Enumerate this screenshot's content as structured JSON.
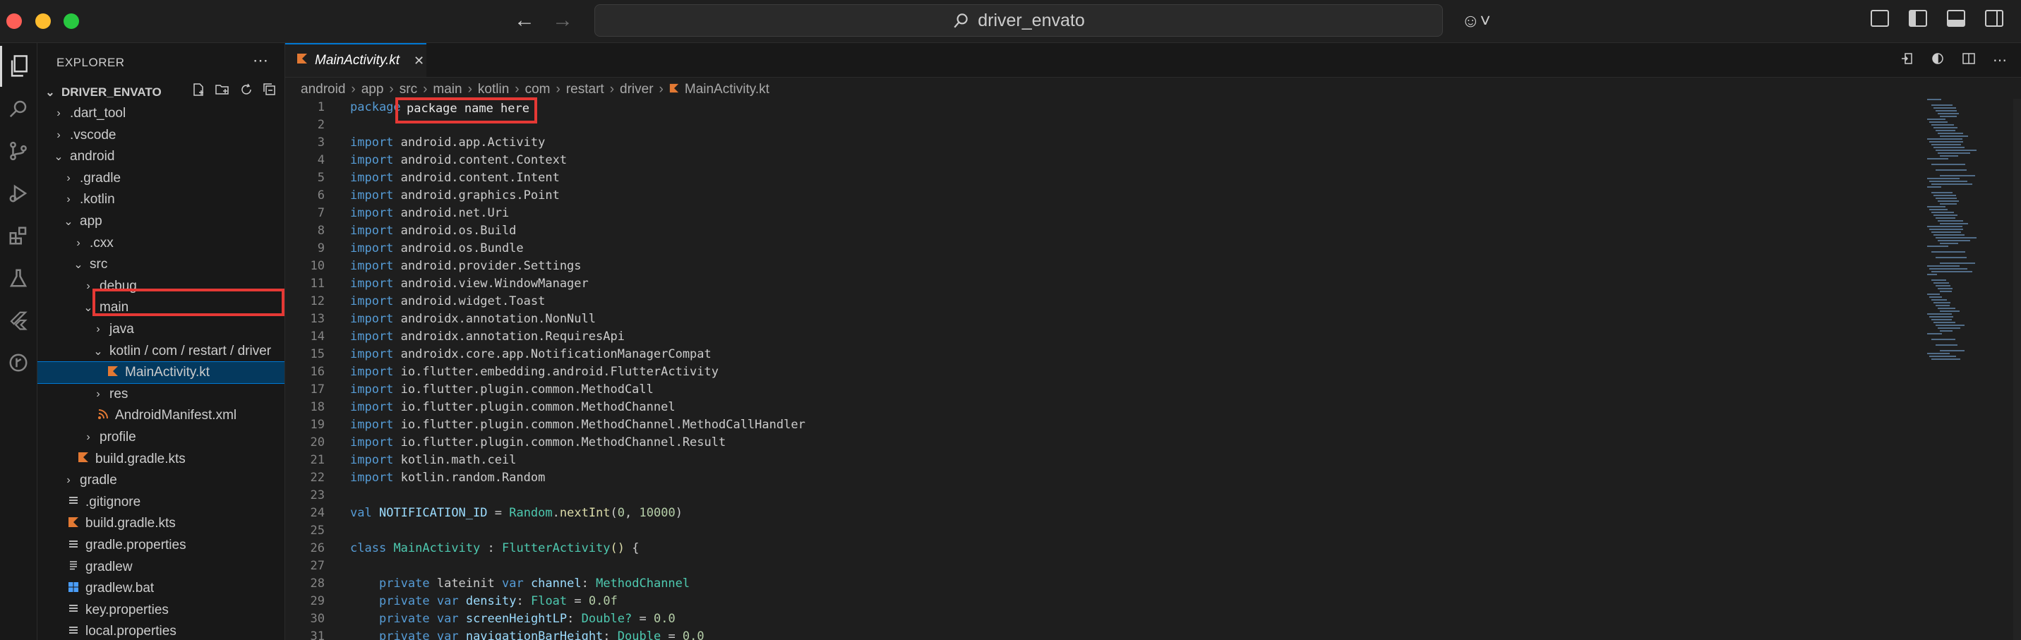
{
  "window": {
    "search_text": "driver_envato"
  },
  "activity_bar": {
    "icons": [
      "explorer-icon",
      "search-icon",
      "source-control-icon",
      "run-debug-icon",
      "extensions-icon",
      "testing-icon",
      "flutter-icon",
      "git-graph-icon"
    ]
  },
  "sidebar": {
    "header": "EXPLORER",
    "root_label": "DRIVER_ENVATO",
    "tree": [
      {
        "label": ".dart_tool",
        "depth": 0,
        "chevron": "right"
      },
      {
        "label": ".vscode",
        "depth": 0,
        "chevron": "right"
      },
      {
        "label": "android",
        "depth": 0,
        "chevron": "down"
      },
      {
        "label": ".gradle",
        "depth": 1,
        "chevron": "right"
      },
      {
        "label": ".kotlin",
        "depth": 1,
        "chevron": "right"
      },
      {
        "label": "app",
        "depth": 1,
        "chevron": "down"
      },
      {
        "label": ".cxx",
        "depth": 2,
        "chevron": "right"
      },
      {
        "label": "src",
        "depth": 2,
        "chevron": "down"
      },
      {
        "label": "debug",
        "depth": 3,
        "chevron": "right"
      },
      {
        "label": "main",
        "depth": 3,
        "chevron": "down"
      },
      {
        "label": "java",
        "depth": 4,
        "chevron": "right"
      },
      {
        "label": "kotlin / com / restart / driver",
        "depth": 4,
        "chevron": "down"
      },
      {
        "label": "MainActivity.kt",
        "depth": 5,
        "icon": "kotlin",
        "selected": true
      },
      {
        "label": "res",
        "depth": 4,
        "chevron": "right"
      },
      {
        "label": "AndroidManifest.xml",
        "depth": 4,
        "icon": "xml"
      },
      {
        "label": "profile",
        "depth": 3,
        "chevron": "right"
      },
      {
        "label": "build.gradle.kts",
        "depth": 2,
        "icon": "kotlin"
      },
      {
        "label": "gradle",
        "depth": 1,
        "chevron": "right"
      },
      {
        "label": ".gitignore",
        "depth": 1,
        "icon": "gear"
      },
      {
        "label": "build.gradle.kts",
        "depth": 1,
        "icon": "kotlin"
      },
      {
        "label": "gradle.properties",
        "depth": 1,
        "icon": "gear"
      },
      {
        "label": "gradlew",
        "depth": 1,
        "icon": "lines"
      },
      {
        "label": "gradlew.bat",
        "depth": 1,
        "icon": "windows"
      },
      {
        "label": "key.properties",
        "depth": 1,
        "icon": "gear"
      },
      {
        "label": "local.properties",
        "depth": 1,
        "icon": "gear"
      }
    ]
  },
  "editor": {
    "tab_label": "MainActivity.kt",
    "breadcrumb": [
      "android",
      "app",
      "src",
      "main",
      "kotlin",
      "com",
      "restart",
      "driver",
      "MainActivity.kt"
    ],
    "package_placeholder": "package name here",
    "lines": [
      [
        [
          "k",
          "package"
        ],
        [
          "p",
          " "
        ]
      ],
      [],
      [
        [
          "k",
          "import"
        ],
        [
          "p",
          " android.app.Activity"
        ]
      ],
      [
        [
          "k",
          "import"
        ],
        [
          "p",
          " android.content.Context"
        ]
      ],
      [
        [
          "k",
          "import"
        ],
        [
          "p",
          " android.content.Intent"
        ]
      ],
      [
        [
          "k",
          "import"
        ],
        [
          "p",
          " android.graphics.Point"
        ]
      ],
      [
        [
          "k",
          "import"
        ],
        [
          "p",
          " android.net.Uri"
        ]
      ],
      [
        [
          "k",
          "import"
        ],
        [
          "p",
          " android.os.Build"
        ]
      ],
      [
        [
          "k",
          "import"
        ],
        [
          "p",
          " android.os.Bundle"
        ]
      ],
      [
        [
          "k",
          "import"
        ],
        [
          "p",
          " android.provider.Settings"
        ]
      ],
      [
        [
          "k",
          "import"
        ],
        [
          "p",
          " android.view.WindowManager"
        ]
      ],
      [
        [
          "k",
          "import"
        ],
        [
          "p",
          " android.widget.Toast"
        ]
      ],
      [
        [
          "k",
          "import"
        ],
        [
          "p",
          " androidx.annotation.NonNull"
        ]
      ],
      [
        [
          "k",
          "import"
        ],
        [
          "p",
          " androidx.annotation.RequiresApi"
        ]
      ],
      [
        [
          "k",
          "import"
        ],
        [
          "p",
          " androidx.core.app.NotificationManagerCompat"
        ]
      ],
      [
        [
          "k",
          "import"
        ],
        [
          "p",
          " io.flutter.embedding.android.FlutterActivity"
        ]
      ],
      [
        [
          "k",
          "import"
        ],
        [
          "p",
          " io.flutter.plugin.common.MethodCall"
        ]
      ],
      [
        [
          "k",
          "import"
        ],
        [
          "p",
          " io.flutter.plugin.common.MethodChannel"
        ]
      ],
      [
        [
          "k",
          "import"
        ],
        [
          "p",
          " io.flutter.plugin.common.MethodChannel.MethodCallHandler"
        ]
      ],
      [
        [
          "k",
          "import"
        ],
        [
          "p",
          " io.flutter.plugin.common.MethodChannel.Result"
        ]
      ],
      [
        [
          "k",
          "import"
        ],
        [
          "p",
          " kotlin.math.ceil"
        ]
      ],
      [
        [
          "k",
          "import"
        ],
        [
          "p",
          " kotlin.random.Random"
        ]
      ],
      [],
      [
        [
          "k",
          "val"
        ],
        [
          "p",
          " "
        ],
        [
          "v",
          "NOTIFICATION_ID"
        ],
        [
          "p",
          " = "
        ],
        [
          "t",
          "Random"
        ],
        [
          "p",
          "."
        ],
        [
          "f",
          "nextInt"
        ],
        [
          "p",
          "("
        ],
        [
          "n",
          "0"
        ],
        [
          "p",
          ", "
        ],
        [
          "n",
          "10000"
        ],
        [
          "p",
          ")"
        ]
      ],
      [],
      [
        [
          "k",
          "class"
        ],
        [
          "p",
          " "
        ],
        [
          "t",
          "MainActivity"
        ],
        [
          "p",
          " : "
        ],
        [
          "t",
          "FlutterActivity"
        ],
        [
          "f",
          "()"
        ],
        [
          "p",
          " {"
        ]
      ],
      [],
      [
        [
          "p",
          "    "
        ],
        [
          "k",
          "private"
        ],
        [
          "p",
          " lateinit "
        ],
        [
          "k",
          "var"
        ],
        [
          "p",
          " "
        ],
        [
          "v",
          "channel"
        ],
        [
          "p",
          ": "
        ],
        [
          "t",
          "MethodChannel"
        ]
      ],
      [
        [
          "p",
          "    "
        ],
        [
          "k",
          "private"
        ],
        [
          "p",
          " "
        ],
        [
          "k",
          "var"
        ],
        [
          "p",
          " "
        ],
        [
          "v",
          "density"
        ],
        [
          "p",
          ": "
        ],
        [
          "t",
          "Float"
        ],
        [
          "p",
          " = "
        ],
        [
          "n",
          "0.0f"
        ]
      ],
      [
        [
          "p",
          "    "
        ],
        [
          "k",
          "private"
        ],
        [
          "p",
          " "
        ],
        [
          "k",
          "var"
        ],
        [
          "p",
          " "
        ],
        [
          "v",
          "screenHeightLP"
        ],
        [
          "p",
          ": "
        ],
        [
          "t",
          "Double?"
        ],
        [
          "p",
          " = "
        ],
        [
          "n",
          "0.0"
        ]
      ],
      [
        [
          "p",
          "    "
        ],
        [
          "k",
          "private"
        ],
        [
          "p",
          " "
        ],
        [
          "k",
          "var"
        ],
        [
          "p",
          " "
        ],
        [
          "v",
          "navigationBarHeight"
        ],
        [
          "p",
          ": "
        ],
        [
          "t",
          "Double"
        ],
        [
          "p",
          " = "
        ],
        [
          "n",
          "0.0"
        ]
      ]
    ]
  }
}
